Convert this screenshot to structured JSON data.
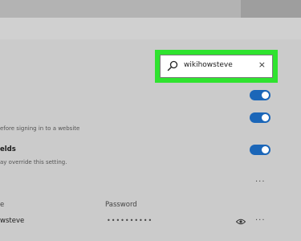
{
  "search": {
    "value": "wikihowsteve",
    "clear_glyph": "×",
    "icon": "search-icon",
    "highlight_color": "#2fe32f"
  },
  "settings": {
    "description_1": "efore signing in to a website",
    "heading_2": "elds",
    "description_2": "ay override this setting."
  },
  "passwords_table": {
    "column_site": "e",
    "column_password": "Password",
    "more_glyph": "···",
    "row": {
      "username": "wsteve",
      "password_mask": "••••••••••",
      "reveal_icon": "eye-icon",
      "more_glyph": "···"
    }
  },
  "colors": {
    "toggle_on": "#1b66b8"
  },
  "toggles": [
    {
      "state": "on"
    },
    {
      "state": "on"
    },
    {
      "state": "on"
    }
  ]
}
